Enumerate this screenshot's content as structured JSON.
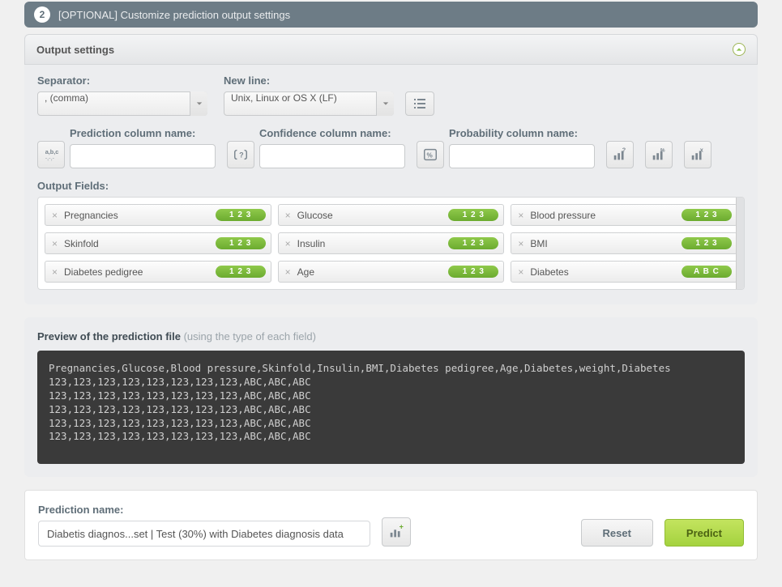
{
  "step": {
    "num": "2",
    "title": "[OPTIONAL] Customize prediction output settings"
  },
  "section": {
    "title": "Output settings"
  },
  "labels": {
    "separator": "Separator:",
    "newline": "New line:",
    "prediction_col": "Prediction column name:",
    "confidence_col": "Confidence column name:",
    "probability_col": "Probability column name:",
    "output_fields": "Output Fields:",
    "preview_title": "Preview of the prediction file ",
    "preview_sub": "(using the type of each field)",
    "prediction_name": "Prediction name:"
  },
  "values": {
    "separator": ", (comma)",
    "newline": "Unix, Linux or OS X (LF)",
    "prediction_col": "",
    "confidence_col": "",
    "probability_col": "",
    "prediction_name": "Diabetis diagnos...set | Test (30%) with Diabetes diagnosis data"
  },
  "icons": {
    "list": "list-icon",
    "abc": "abc-icon",
    "q": "question-braces-icon",
    "pct": "percent-box-icon",
    "bar_q": "bar-question-icon",
    "bar_pct": "bar-percent-icon",
    "bar_x": "bar-x-icon",
    "chart_plus": "chart-plus-icon"
  },
  "badges": {
    "num": "1 2 3",
    "abc": "A B C"
  },
  "fields": [
    {
      "name": "Pregnancies",
      "type": "num"
    },
    {
      "name": "Glucose",
      "type": "num"
    },
    {
      "name": "Blood pressure",
      "type": "num"
    },
    {
      "name": "Skinfold",
      "type": "num"
    },
    {
      "name": "Insulin",
      "type": "num"
    },
    {
      "name": "BMI",
      "type": "num"
    },
    {
      "name": "Diabetes pedigree",
      "type": "num"
    },
    {
      "name": "Age",
      "type": "num"
    },
    {
      "name": "Diabetes",
      "type": "abc"
    }
  ],
  "preview_lines": [
    "Pregnancies,Glucose,Blood pressure,Skinfold,Insulin,BMI,Diabetes pedigree,Age,Diabetes,weight,Diabetes",
    "123,123,123,123,123,123,123,123,ABC,ABC,ABC",
    "123,123,123,123,123,123,123,123,ABC,ABC,ABC",
    "123,123,123,123,123,123,123,123,ABC,ABC,ABC",
    "123,123,123,123,123,123,123,123,ABC,ABC,ABC",
    "123,123,123,123,123,123,123,123,ABC,ABC,ABC"
  ],
  "buttons": {
    "reset": "Reset",
    "predict": "Predict"
  }
}
